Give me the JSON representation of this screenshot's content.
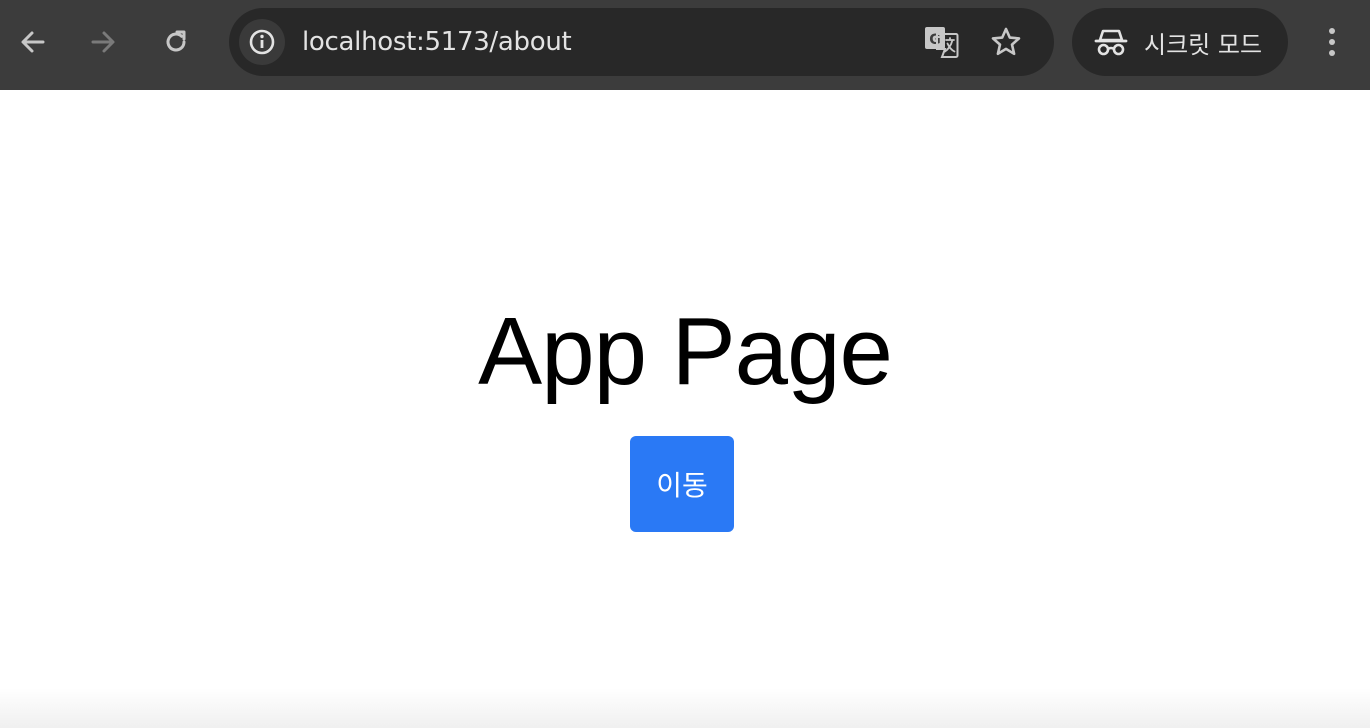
{
  "browser": {
    "url": "localhost:5173/about",
    "incognito_label": "시크릿 모드",
    "icons": {
      "back": "arrow-left-icon",
      "forward": "arrow-right-icon",
      "reload": "reload-icon",
      "site_info": "info-icon",
      "translate": "translate-icon",
      "bookmark": "star-icon",
      "incognito": "incognito-icon",
      "menu": "kebab-menu-icon"
    }
  },
  "page": {
    "title": "App Page",
    "button_label": "이동"
  },
  "colors": {
    "toolbar_bg": "#3c3c3c",
    "omnibox_bg": "#282828",
    "button_bg": "#2a79f5",
    "button_text": "#ffffff",
    "title_text": "#000000"
  }
}
